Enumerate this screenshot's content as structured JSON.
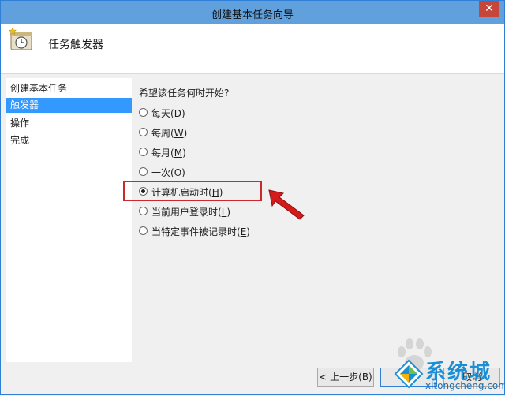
{
  "window": {
    "title": "创建基本任务向导",
    "close_glyph": "✕"
  },
  "header": {
    "title": "任务触发器",
    "icon": "scheduled-task-icon"
  },
  "sidebar": {
    "items": [
      {
        "label": "创建基本任务",
        "active": false
      },
      {
        "label": "触发器",
        "active": true
      },
      {
        "label": "操作",
        "active": false
      },
      {
        "label": "完成",
        "active": false
      }
    ]
  },
  "content": {
    "question": "希望该任务何时开始?",
    "options": [
      {
        "label": "每天",
        "key": "D",
        "checked": false
      },
      {
        "label": "每周",
        "key": "W",
        "checked": false
      },
      {
        "label": "每月",
        "key": "M",
        "checked": false
      },
      {
        "label": "一次",
        "key": "O",
        "checked": false
      },
      {
        "label": "计算机启动时",
        "key": "H",
        "checked": true
      },
      {
        "label": "当前用户登录时",
        "key": "L",
        "checked": false
      },
      {
        "label": "当特定事件被记录时",
        "key": "E",
        "checked": false
      }
    ]
  },
  "footer": {
    "back_label": "< 上一步(B)",
    "next_label": "下",
    "cancel_label": "取消"
  },
  "watermark": {
    "text": "系统城",
    "url_text": "xitongcheng.com"
  },
  "colors": {
    "title_bar": "#5fa0dd",
    "active_item": "#3399ff",
    "highlight": "#cc2a2a",
    "arrow": "#d41a1a"
  }
}
